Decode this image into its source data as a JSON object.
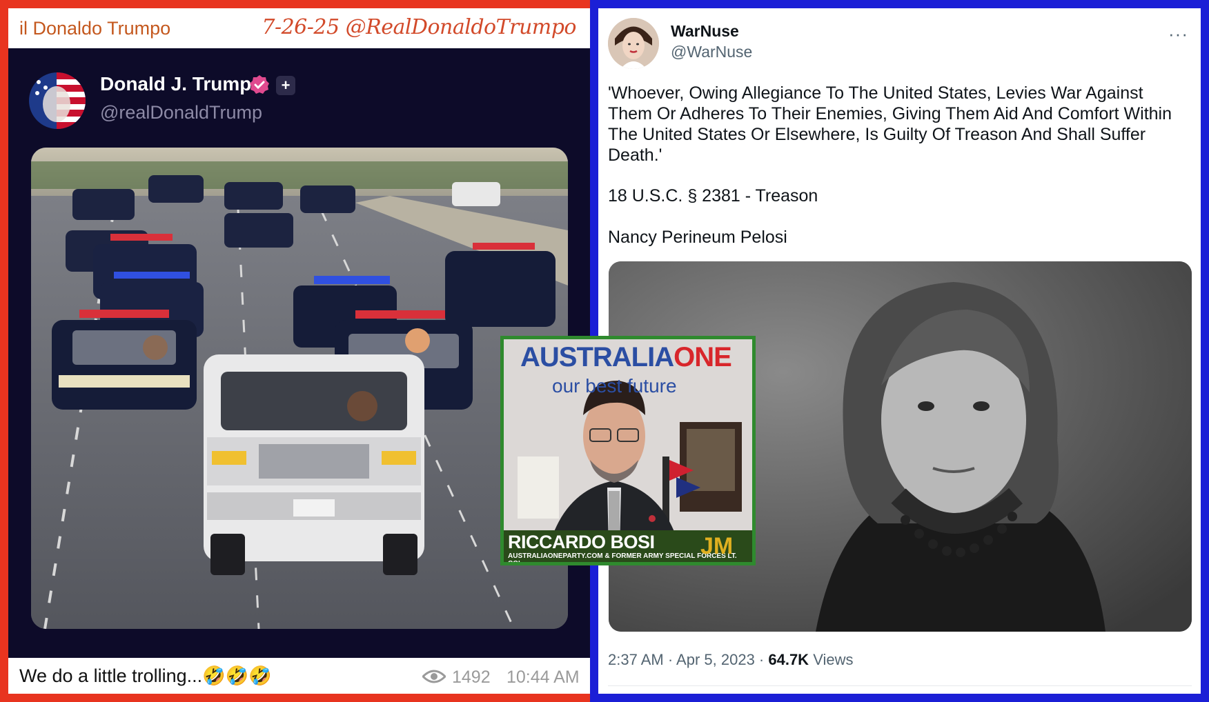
{
  "left_post": {
    "channel_name": "il Donaldo Trumpo",
    "date_tag": "7-26-25 @RealDonaldoTrumpo",
    "author_name": "Donald J. Trump",
    "author_handle": "@realDonaldTrump",
    "plus_label": "+",
    "caption": "We do a little trolling...🤣🤣🤣",
    "views": "1492",
    "time": "10:44 AM"
  },
  "right_post": {
    "name": "WarNuse",
    "handle": "@WarNuse",
    "more_label": "···",
    "quote": "'Whoever, Owing Allegiance To The United States, Levies War Against Them Or Adheres To Their Enemies, Giving Them Aid And Comfort Within The United States Or Elsewhere, Is Guilty Of Treason And Shall Suffer Death.'",
    "statute": "18 U.S.C. § 2381 - Treason",
    "signoff": "Nancy Perineum Pelosi",
    "meta_time": "2:37 AM · Apr 5, 2023 · ",
    "meta_views": "64.7K",
    "meta_views_label": " Views"
  },
  "inset": {
    "brand_a": "AUSTRALIA",
    "brand_b": "ONE",
    "tagline": "our best future",
    "speaker": "RICCARDO BOSI",
    "credit": "AUSTRALIAONEPARTY.COM & FORMER ARMY SPECIAL FORCES LT. COL.",
    "corner_mark": "JM"
  },
  "colors": {
    "left_frame": "#e8341f",
    "right_frame": "#1b1fd6",
    "inset_border": "#2f8a2e",
    "card_bg": "#0d0b29"
  },
  "icons": [
    "verified-badge-icon",
    "plus-icon",
    "eye-icon",
    "more-options-icon"
  ]
}
